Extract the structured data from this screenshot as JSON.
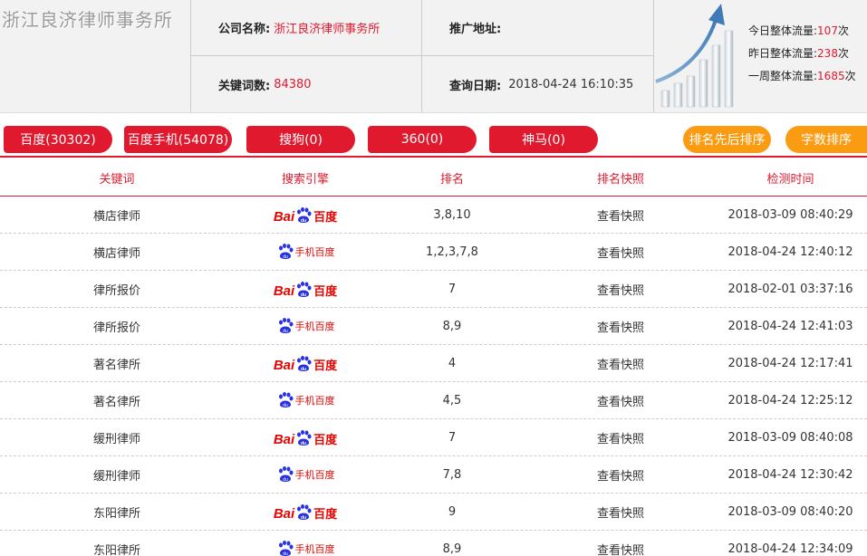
{
  "header": {
    "logo_text": "浙江良济律师事务所",
    "company_label": "公司名称:",
    "company_value": "浙江良济律师事务所",
    "promo_label": "推广地址:",
    "promo_value": "",
    "keywords_label": "关键词数:",
    "keywords_value": "84380",
    "query_label": "查询日期:",
    "query_value": "2018-04-24 16:10:35"
  },
  "traffic": {
    "today_label": "今日整体流量:",
    "today_value": "107",
    "yesterday_label": "昨日整体流量:",
    "yesterday_value": "238",
    "week_label": "一周整体流量:",
    "week_value": "1685",
    "unit": "次"
  },
  "tabs": [
    {
      "label": "百度(30302)"
    },
    {
      "label": "百度手机(54078)"
    },
    {
      "label": "搜狗(0)"
    },
    {
      "label": "360(0)"
    },
    {
      "label": "神马(0)"
    }
  ],
  "sort_buttons": [
    {
      "label": "排名先后排序"
    },
    {
      "label": "字数排序"
    }
  ],
  "table": {
    "headers": [
      "关键词",
      "搜索引擎",
      "排名",
      "排名快照",
      "检测时间"
    ],
    "rows": [
      {
        "keyword": "横店律师",
        "engine": "baidu",
        "rank": "3,8,10",
        "snapshot": "查看快照",
        "time": "2018-03-09 08:40:29"
      },
      {
        "keyword": "横店律师",
        "engine": "baidu-mobile",
        "rank": "1,2,3,7,8",
        "snapshot": "查看快照",
        "time": "2018-04-24 12:40:12"
      },
      {
        "keyword": "律所报价",
        "engine": "baidu",
        "rank": "7",
        "snapshot": "查看快照",
        "time": "2018-02-01 03:37:16"
      },
      {
        "keyword": "律所报价",
        "engine": "baidu-mobile",
        "rank": "8,9",
        "snapshot": "查看快照",
        "time": "2018-04-24 12:41:03"
      },
      {
        "keyword": "著名律所",
        "engine": "baidu",
        "rank": "4",
        "snapshot": "查看快照",
        "time": "2018-04-24 12:17:41"
      },
      {
        "keyword": "著名律所",
        "engine": "baidu-mobile",
        "rank": "4,5",
        "snapshot": "查看快照",
        "time": "2018-04-24 12:25:12"
      },
      {
        "keyword": "缓刑律师",
        "engine": "baidu",
        "rank": "7",
        "snapshot": "查看快照",
        "time": "2018-03-09 08:40:08"
      },
      {
        "keyword": "缓刑律师",
        "engine": "baidu-mobile",
        "rank": "7,8",
        "snapshot": "查看快照",
        "time": "2018-04-24 12:30:42"
      },
      {
        "keyword": "东阳律所",
        "engine": "baidu",
        "rank": "9",
        "snapshot": "查看快照",
        "time": "2018-03-09 08:40:20"
      },
      {
        "keyword": "东阳律所",
        "engine": "baidu-mobile",
        "rank": "8,9",
        "snapshot": "查看快照",
        "time": "2018-04-24 12:34:09"
      }
    ]
  },
  "logos": {
    "baidu_latin": "Bai",
    "baidu_cn": "百度",
    "baidu_mobile_cn": "手机百度"
  },
  "colors": {
    "accent_red": "#e0192e",
    "sort_orange": "#fb9b11",
    "baidu_red": "#e10602",
    "baidu_blue": "#2932e1"
  }
}
